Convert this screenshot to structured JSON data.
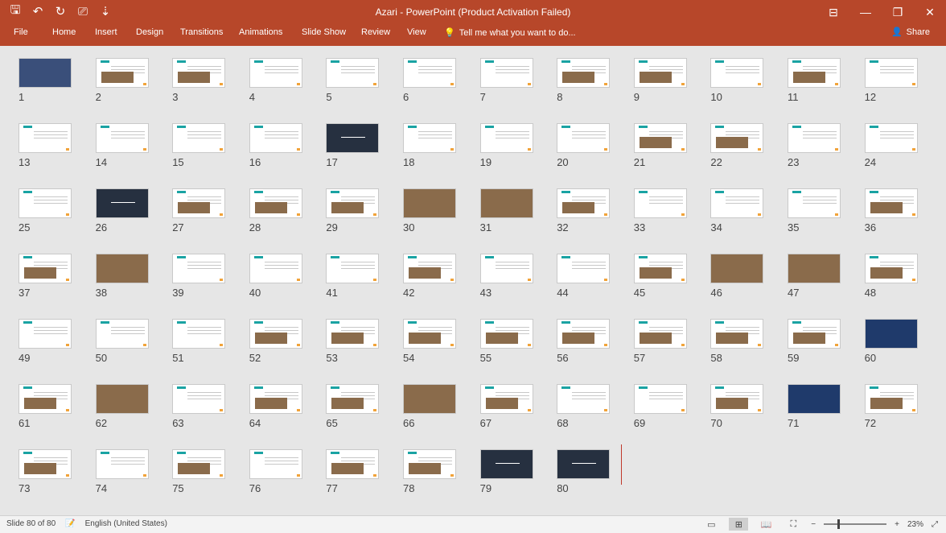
{
  "window": {
    "title": "Azari - PowerPoint (Product Activation Failed)"
  },
  "quick_access": {
    "save_glyph": "🖫",
    "undo_glyph": "↶",
    "redo_glyph": "↻",
    "present_glyph": "⎚",
    "customize_glyph": "⇣"
  },
  "window_controls": {
    "ribbon_display_glyph": "⊟",
    "minimize_glyph": "—",
    "restore_glyph": "❐",
    "close_glyph": "✕"
  },
  "ribbon": {
    "tabs": [
      "File",
      "Home",
      "Insert",
      "Design",
      "Transitions",
      "Animations",
      "Slide Show",
      "Review",
      "View"
    ],
    "tell_me": "Tell me what you want to do...",
    "tell_me_glyph": "💡",
    "share": "Share",
    "share_glyph": "👤"
  },
  "slides": [
    "1",
    "2",
    "3",
    "4",
    "5",
    "6",
    "7",
    "8",
    "9",
    "10",
    "11",
    "12",
    "13",
    "14",
    "15",
    "16",
    "17",
    "18",
    "19",
    "20",
    "21",
    "22",
    "23",
    "24",
    "25",
    "26",
    "27",
    "28",
    "29",
    "30",
    "31",
    "32",
    "33",
    "34",
    "35",
    "36",
    "37",
    "38",
    "39",
    "40",
    "41",
    "42",
    "43",
    "44",
    "45",
    "46",
    "47",
    "48",
    "49",
    "50",
    "51",
    "52",
    "53",
    "54",
    "55",
    "56",
    "57",
    "58",
    "59",
    "60",
    "61",
    "62",
    "63",
    "64",
    "65",
    "66",
    "67",
    "68",
    "69",
    "70",
    "71",
    "72",
    "73",
    "74",
    "75",
    "76",
    "77",
    "78",
    "79",
    "80"
  ],
  "status": {
    "slide_info": "Slide 80 of 80",
    "notes_glyph": "📝",
    "language": "English (United States)",
    "view_normal_glyph": "▭",
    "view_sorter_glyph": "⊞",
    "view_reading_glyph": "📖",
    "view_slideshow_glyph": "⛶",
    "zoom_out_glyph": "−",
    "zoom_in_glyph": "+",
    "zoom": "23%",
    "fit_glyph": "⤢",
    "zoom_fraction": 0.23
  },
  "colors": {
    "accent": "#b7472a",
    "teal": "#1aa3a3",
    "orange": "#f1a33a"
  }
}
